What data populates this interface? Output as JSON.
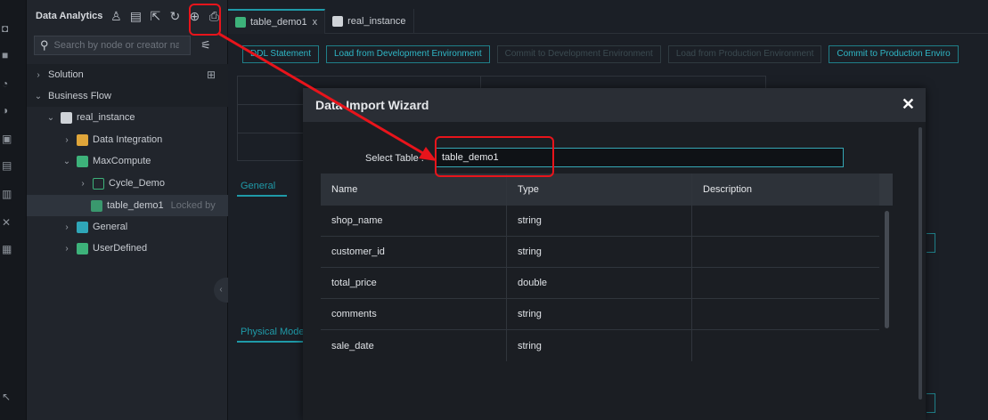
{
  "side": {
    "title": "Data Analytics",
    "search_placeholder": "Search by node or creator name",
    "header_icons": [
      "user-icon",
      "document-icon",
      "export-icon",
      "refresh-icon",
      "globe-icon",
      "import-icon"
    ],
    "tree": {
      "solution": "Solution",
      "business_flow": "Business Flow",
      "real_instance": "real_instance",
      "data_integration": "Data Integration",
      "maxcompute": "MaxCompute",
      "cycle_demo": "Cycle_Demo",
      "table_demo1": "table_demo1",
      "locked_by": "Locked by",
      "general": "General",
      "user_defined": "UserDefined"
    }
  },
  "tabs": {
    "tab1": "table_demo1",
    "tab1_close": "x",
    "tab2": "real_instance"
  },
  "toolbar": {
    "ddl": "DDL Statement",
    "load_dev": "Load from Development Environment",
    "commit_dev": "Commit to Development Environment",
    "load_prod": "Load from Production Environment",
    "commit_prod": "Commit to Production Enviro"
  },
  "background": {
    "general_tab": "General",
    "physical_tab": "Physical Mode"
  },
  "modal": {
    "title": "Data Import Wizard",
    "close": "✕",
    "select_label": "Select Table :",
    "select_value": "table_demo1",
    "columns": [
      "Name",
      "Type",
      "Description"
    ],
    "rows": [
      {
        "name": "shop_name",
        "type": "string",
        "description": ""
      },
      {
        "name": "customer_id",
        "type": "string",
        "description": ""
      },
      {
        "name": "total_price",
        "type": "double",
        "description": ""
      },
      {
        "name": "comments",
        "type": "string",
        "description": ""
      },
      {
        "name": "sale_date",
        "type": "string",
        "description": ""
      }
    ]
  },
  "colors": {
    "accent": "#1f9aa8",
    "annotation": "#e8141b"
  }
}
